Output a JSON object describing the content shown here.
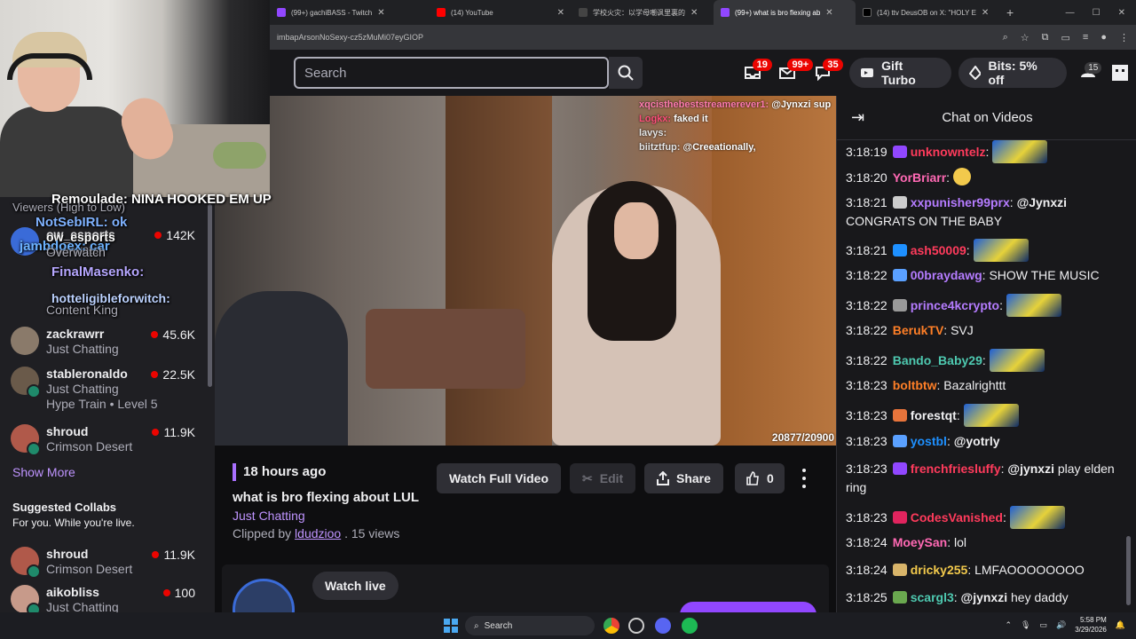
{
  "browser": {
    "tabs": [
      {
        "title": "(99+) gachiBASS - Twitch",
        "color": "#9147ff",
        "active": false
      },
      {
        "title": "(14) YouTube",
        "color": "#ff0000",
        "active": false
      },
      {
        "title": "学校火灾：以学母嘲讽里裏的",
        "color": "#222222",
        "active": false
      },
      {
        "title": "(99+) what is bro flexing ab",
        "color": "#9147ff",
        "active": true
      },
      {
        "title": "(14) ttv DeusOB on X: \"HOLY E",
        "color": "#000000",
        "active": false
      }
    ],
    "new_tab": "+",
    "url": "imbapArsonNoSexy-cz5zMuMi07eyGIOP"
  },
  "topnav": {
    "search_placeholder": "Search",
    "badges": [
      "19",
      "99+",
      "35"
    ],
    "gift_turbo": "Gift Turbo",
    "bits": "Bits: 5% off",
    "gem_count": "15"
  },
  "overlay_chat": [
    {
      "text": "Remoulade: NINA HOOKED EM UP"
    },
    {
      "text": "Viewers (High to Low)"
    },
    {
      "text": "NotSebIRL: ok"
    },
    {
      "text": "ow_esports"
    },
    {
      "text": "jambdoex: car"
    },
    {
      "text": "Overwatch"
    },
    {
      "text": "FinalMasenko:"
    },
    {
      "text": "hotteligibleforwitch:"
    },
    {
      "text": "Content King"
    }
  ],
  "left_channels": [
    {
      "name": "ow_esports",
      "game": "Overwatch",
      "viewers": "142K",
      "avatar": "#3a6bd8"
    },
    {
      "name": "zackrawrr",
      "game": "Just Chatting",
      "viewers": "45.6K",
      "avatar": "#8a7a6a"
    },
    {
      "name": "stableronaldo",
      "game": "Just Chatting",
      "viewers": "22.5K",
      "avatar": "#6a5a4a",
      "extra": "Hype Train • Level 5"
    },
    {
      "name": "shroud",
      "game": "Crimson Desert",
      "viewers": "11.9K",
      "avatar": "#b0594a"
    }
  ],
  "show_more": "Show More",
  "suggested": {
    "title": "Suggested Collabs",
    "subtitle": "For you. While you're live.",
    "channels": [
      {
        "name": "shroud",
        "game": "Crimson Desert",
        "viewers": "11.9K",
        "avatar": "#b0594a"
      },
      {
        "name": "aikobliss",
        "game": "Just Chatting",
        "viewers": "100",
        "avatar": "#c79a8a"
      }
    ]
  },
  "video": {
    "chat_overlay": [
      {
        "user": "xqcisthebeststreamerever1:",
        "msg": "@Jynxzi sup"
      },
      {
        "user": "Logkx:",
        "msg": "faked it"
      },
      {
        "user": "lavys:",
        "msg": ""
      },
      {
        "user": "biitztfup:",
        "msg": "@Creeationally,"
      }
    ],
    "counter": "20877/20900"
  },
  "clip": {
    "time_ago": "18 hours ago",
    "title": "what is bro flexing about LUL",
    "category": "Just Chatting",
    "clipped_by_prefix": "Clipped by",
    "clipper": "ldudzioo",
    "views": ". 15 views",
    "actions": {
      "watch_full": "Watch Full Video",
      "edit": "Edit",
      "share": "Share",
      "likes": "0"
    },
    "watch_live": "Watch live"
  },
  "chat": {
    "title": "Chat on Videos",
    "messages": [
      {
        "ts": "3:18:19",
        "user": "unknowntelz",
        "color": "#ff3b5c",
        "badge": "#9147ff",
        "text": "",
        "emote": "big"
      },
      {
        "ts": "3:18:20",
        "user": "YorBriarr",
        "color": "#ff69b4",
        "badge": "",
        "text": "",
        "emote": "small"
      },
      {
        "ts": "3:18:21",
        "user": "xxpunisher99prx",
        "color": "#b57cff",
        "badge": "#cccccc",
        "text": "CONGRATS ON THE BABY",
        "mention": "@Jynxzi",
        "emote": ""
      },
      {
        "ts": "3:18:21",
        "user": "ash50009",
        "color": "#ff3b5c",
        "badge": "#1e90ff",
        "text": "",
        "emote": "big"
      },
      {
        "ts": "3:18:22",
        "user": "00braydawg",
        "color": "#b57cff",
        "badge": "#5aa0ff",
        "text": "SHOW THE MUSIC",
        "emote": ""
      },
      {
        "ts": "3:18:22",
        "user": "prince4kcrypto",
        "color": "#b57cff",
        "badge": "#999999",
        "text": "",
        "emote": "big"
      },
      {
        "ts": "3:18:22",
        "user": "BerukTV",
        "color": "#ff7f27",
        "badge": "",
        "text": "SVJ",
        "emote": ""
      },
      {
        "ts": "3:18:22",
        "user": "Bando_Baby29",
        "color": "#4ec9b0",
        "badge": "",
        "text": "",
        "emote": "big"
      },
      {
        "ts": "3:18:23",
        "user": "boltbtw",
        "color": "#ff7f27",
        "badge": "",
        "text": "Bazalrighttt",
        "emote": ""
      },
      {
        "ts": "3:18:23",
        "user": "forestqt",
        "color": "#efeff1",
        "badge": "#e8743b",
        "text": "",
        "emote": "big"
      },
      {
        "ts": "3:18:23",
        "user": "yostbl",
        "color": "#1e90ff",
        "badge": "#5aa0ff",
        "text": "",
        "mention": "@yotrly",
        "emote": ""
      },
      {
        "ts": "3:18:23",
        "user": "frenchfriesluffy",
        "color": "#ff3b5c",
        "badge": "#9147ff",
        "text": "play elden ring",
        "mention": "@jynxzi",
        "emote": ""
      },
      {
        "ts": "3:18:23",
        "user": "CodesVanished",
        "color": "#ff3b5c",
        "badge": "#e0245e",
        "text": "",
        "emote": "big"
      },
      {
        "ts": "3:18:24",
        "user": "MoeySan",
        "color": "#ff69b4",
        "badge": "",
        "text": "lol",
        "emote": ""
      },
      {
        "ts": "3:18:24",
        "user": "dricky255",
        "color": "#f2c94c",
        "badge": "#d8b46a",
        "text": "LMFAOOOOOOOO",
        "emote": ""
      },
      {
        "ts": "3:18:25",
        "user": "scargl3",
        "color": "#4ec9b0",
        "badge": "#6aa84f",
        "text": "hey daddy",
        "mention": "@jynxzi",
        "emote": ""
      }
    ]
  },
  "taskbar": {
    "search": "Search",
    "time": "5:58 PM",
    "date": "3/29/2026"
  },
  "colors": {
    "twitch_purple": "#9147ff",
    "live_red": "#eb0400",
    "link_purple": "#bf94ff"
  }
}
